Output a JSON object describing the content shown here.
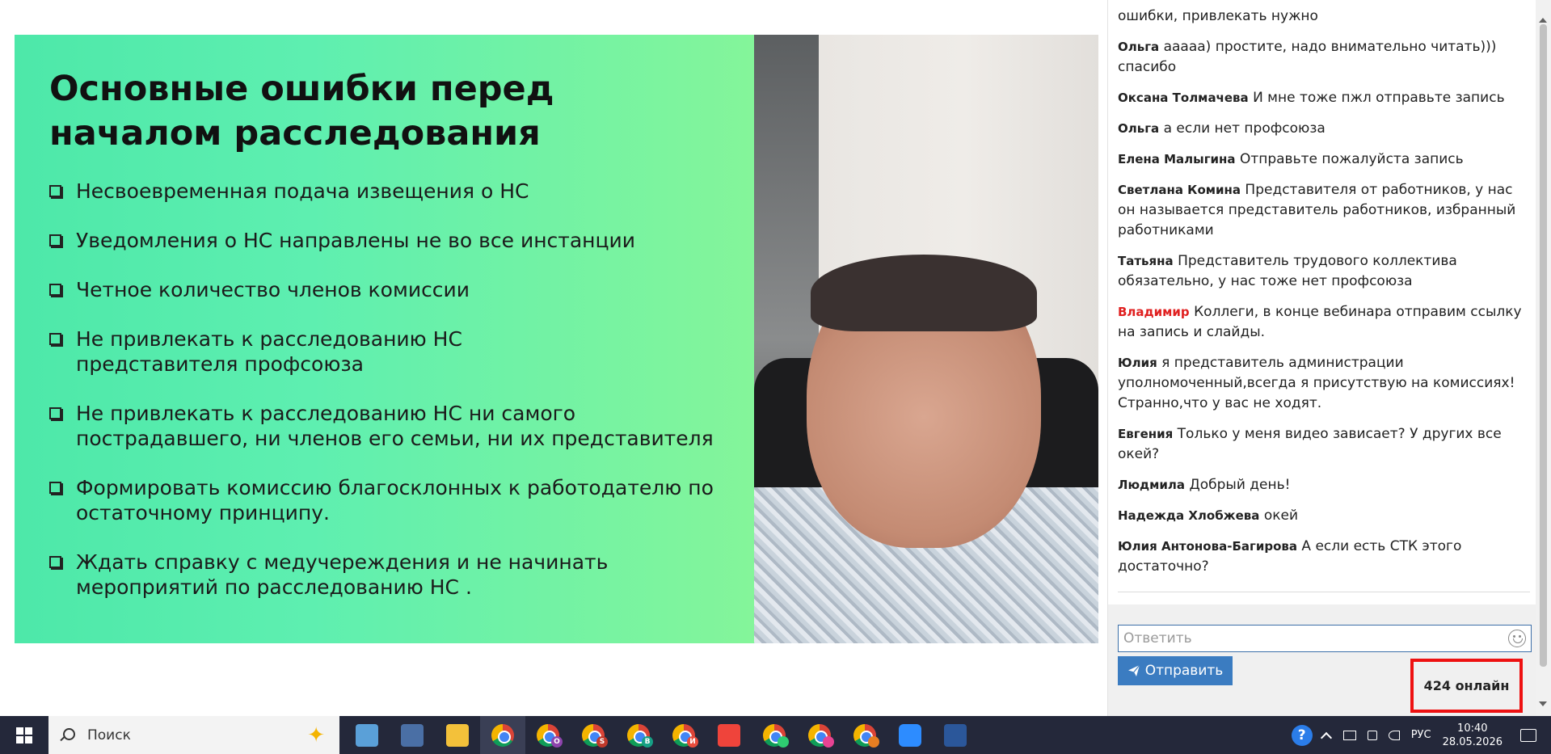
{
  "slide": {
    "title": "Основные ошибки перед началом расследования",
    "items": [
      "Несвоевременная подача извещения о НС",
      "Уведомления о НС направлены не во все инстанции",
      "Четное количество членов комиссии",
      "Не привлекать к расследованию НС представителя профсоюза",
      "Не привлекать к расследованию НС ни самого пострадавшего, ни членов его семьи, ни их представителя",
      "Формировать комиссию благосклонных к работодателю по остаточному принципу.",
      "Ждать справку с медучереждения и не начинать мероприятий по расследованию НС ."
    ]
  },
  "chat": {
    "messages": [
      {
        "author": "",
        "text": "ошибки, привлекать нужно"
      },
      {
        "author": "Ольга",
        "text": "ааааа) простите, надо внимательно читать))) спасибо"
      },
      {
        "author": "Оксана Толмачева",
        "text": "И мне тоже пжл отправьте запись"
      },
      {
        "author": "Ольга",
        "text": "а если нет профсоюза"
      },
      {
        "author": "Елена Малыгина",
        "text": "Отправьте пожалуйста запись"
      },
      {
        "author": "Светлана Комина",
        "text": "Представителя от работников, у нас он называется представитель работников, избранный работниками"
      },
      {
        "author": "Татьяна",
        "text": "Представитель трудового коллектива обязательно, у нас тоже нет профсоюза"
      },
      {
        "author": "Владимир",
        "text": "Коллеги, в конце вебинара отправим ссылку на запись и слайды."
      },
      {
        "author": "Юлия",
        "text": "я представитель администрации уполномоченный,всегда я присутствую на комиссиях! Странно,что у вас не ходят."
      },
      {
        "author": "Евгения",
        "text": "Только у меня видео зависает? У других все окей?"
      },
      {
        "author": "Людмила",
        "text": "Добрый день!"
      },
      {
        "author": "Надежда Хлобжева",
        "text": "окей"
      },
      {
        "author": "Юлия Антонова-Багирова",
        "text": "А если есть СТК этого достаточно?"
      }
    ],
    "reply_placeholder": "Ответить",
    "send_label": "Отправить",
    "online_count": "424 онлайн",
    "highlight_color": "#e02020",
    "accent_color": "#3b7cc1"
  },
  "taskbar": {
    "search_label": "Поиск",
    "apps": [
      {
        "name": "notepad-icon",
        "color": "#5aa0d8"
      },
      {
        "name": "calculator-icon",
        "color": "#4a6fa5"
      },
      {
        "name": "file-explorer-icon",
        "color": "#f3c13a"
      },
      {
        "name": "chrome-icon",
        "badge": "",
        "active": true
      },
      {
        "name": "chrome-icon",
        "badge": "O",
        "badge_color": "#8e44ad"
      },
      {
        "name": "chrome-icon",
        "badge": "S",
        "badge_color": "#c0392b"
      },
      {
        "name": "chrome-icon",
        "badge": "B",
        "badge_color": "#16a085"
      },
      {
        "name": "chrome-icon",
        "badge": "И",
        "badge_color": "#e74c3c"
      },
      {
        "name": "anydesk-icon",
        "color": "#ef443b"
      },
      {
        "name": "chrome-icon",
        "badge": "",
        "badge_color": "#2ecc71"
      },
      {
        "name": "chrome-icon",
        "badge": "",
        "badge_color": "#e84393"
      },
      {
        "name": "chrome-icon",
        "badge": "",
        "badge_color": "#e67e22"
      },
      {
        "name": "zoom-icon",
        "color": "#2d8cff"
      },
      {
        "name": "word-icon",
        "color": "#2b579a"
      }
    ],
    "language": "РУС",
    "time": "10:40",
    "date": "28.05.2026"
  }
}
